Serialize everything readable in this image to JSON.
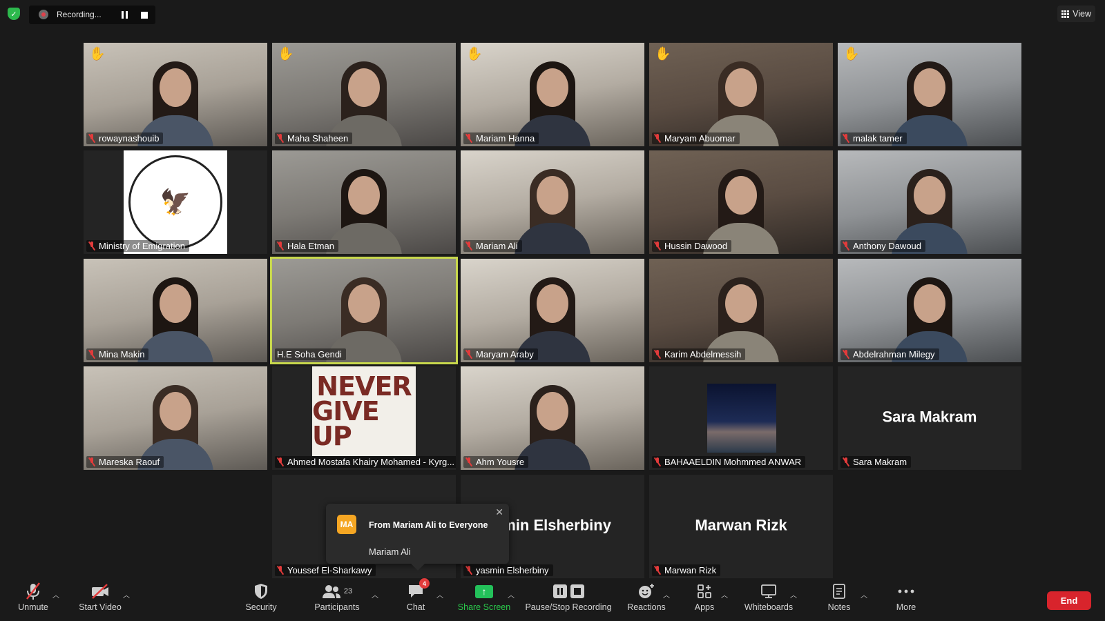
{
  "colors": {
    "background": "#1a1a1a",
    "tile": "#242424",
    "active_speaker_border": "#c8d84c",
    "muted_mic": "#e23b3b",
    "share_green": "#23c15a",
    "end_red": "#d8242c",
    "raised_hand": "#f4b43c"
  },
  "topbar": {
    "security_icon": "shield-check-icon",
    "recording_label": "Recording...",
    "view_label": "View"
  },
  "tiles": [
    {
      "name": "rowaynashouib",
      "hand": true,
      "type": "video"
    },
    {
      "name": "Maha Shaheen",
      "hand": true,
      "type": "video"
    },
    {
      "name": "Mariam Hanna",
      "hand": true,
      "type": "video"
    },
    {
      "name": "Maryam Abuomar",
      "hand": true,
      "type": "video"
    },
    {
      "name": "malak tamer",
      "hand": true,
      "type": "video"
    },
    {
      "name": "Ministry of Emigration",
      "hand": false,
      "type": "logo"
    },
    {
      "name": "Hala Etman",
      "hand": false,
      "type": "video"
    },
    {
      "name": "Mariam Ali",
      "hand": false,
      "type": "video"
    },
    {
      "name": "Hussin Dawood",
      "hand": false,
      "type": "video"
    },
    {
      "name": "Anthony Dawoud",
      "hand": false,
      "type": "video"
    },
    {
      "name": "Mina Makin",
      "hand": false,
      "type": "video"
    },
    {
      "name": "H.E Soha Gendi",
      "hand": false,
      "type": "video",
      "active_speaker": true
    },
    {
      "name": "Maryam Araby",
      "hand": false,
      "type": "video"
    },
    {
      "name": "Karim Abdelmessih",
      "hand": false,
      "type": "video"
    },
    {
      "name": "Abdelrahman Milegy",
      "hand": false,
      "type": "video"
    },
    {
      "name": "Mareska Raouf",
      "hand": false,
      "type": "video"
    },
    {
      "name": "Ahmed Mostafa Khairy Mohamed - Kyrg...",
      "hand": false,
      "type": "poster",
      "poster_line1": "NEVER",
      "poster_line2": "GIVE UP"
    },
    {
      "name": "Ahm Yousre",
      "hand": false,
      "type": "video"
    },
    {
      "name": "BAHAAELDIN Mohmmed ANWAR",
      "hand": false,
      "type": "night"
    },
    {
      "name": "Sara Makram",
      "hand": false,
      "type": "name",
      "display_name": "Sara Makram"
    },
    {
      "name": "Youssef El-Sharkawy",
      "hand": false,
      "type": "name",
      "display_name": "You"
    },
    {
      "name": "yasmin Elsherbiny",
      "hand": false,
      "type": "name",
      "display_name": "smin Elsherbiny"
    },
    {
      "name": "Marwan Rizk",
      "hand": false,
      "type": "name",
      "display_name": "Marwan Rizk"
    }
  ],
  "chat_popup": {
    "avatar_initials": "MA",
    "header": "From Mariam Ali to Everyone",
    "message": "Mariam Ali"
  },
  "toolbar": {
    "unmute": "Unmute",
    "start_video": "Start Video",
    "security": "Security",
    "participants": "Participants",
    "participants_count": "23",
    "chat": "Chat",
    "chat_badge": "4",
    "share_screen": "Share Screen",
    "pause_stop_recording": "Pause/Stop Recording",
    "reactions": "Reactions",
    "apps": "Apps",
    "whiteboards": "Whiteboards",
    "notes": "Notes",
    "more": "More",
    "end": "End"
  }
}
